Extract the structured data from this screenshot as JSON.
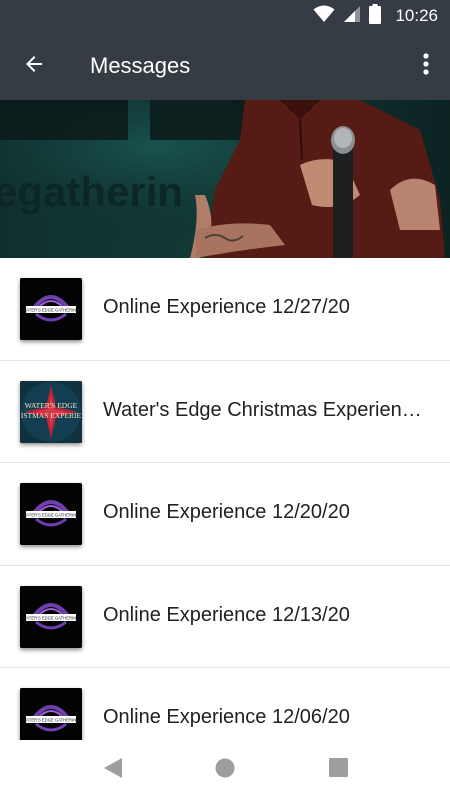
{
  "status_bar": {
    "time": "10:26",
    "icons": [
      "wifi-icon",
      "signal-icon",
      "battery-icon"
    ]
  },
  "app_bar": {
    "title": "Messages",
    "back_icon": "arrow-back-icon",
    "menu_icon": "more-vert-icon"
  },
  "hero": {
    "background_text": "egatherin"
  },
  "messages": [
    {
      "title": "Online Experience 12/27/20",
      "thumb_text": "WATER'S EDGE GATHERING",
      "thumb_style": "logo"
    },
    {
      "title": "Water's Edge Christmas Experien…",
      "thumb_text": "WATER'S EDGE CHRISTMAS EXPERIE",
      "thumb_style": "christmas"
    },
    {
      "title": "Online Experience 12/20/20",
      "thumb_text": "WATER'S EDGE GATHERING",
      "thumb_style": "logo"
    },
    {
      "title": "Online Experience 12/13/20",
      "thumb_text": "WATER'S EDGE GATHERING",
      "thumb_style": "logo"
    },
    {
      "title": "Online Experience 12/06/20",
      "thumb_text": "WATER'S EDGE GATHERING",
      "thumb_style": "logo"
    }
  ],
  "nav_bar": {
    "icons": [
      "back-triangle-icon",
      "home-circle-icon",
      "recents-square-icon"
    ]
  },
  "colors": {
    "app_bar": "#353c43",
    "text_primary": "#212121",
    "divider": "#e4e4e4",
    "nav_icon": "#9e9e9e"
  }
}
